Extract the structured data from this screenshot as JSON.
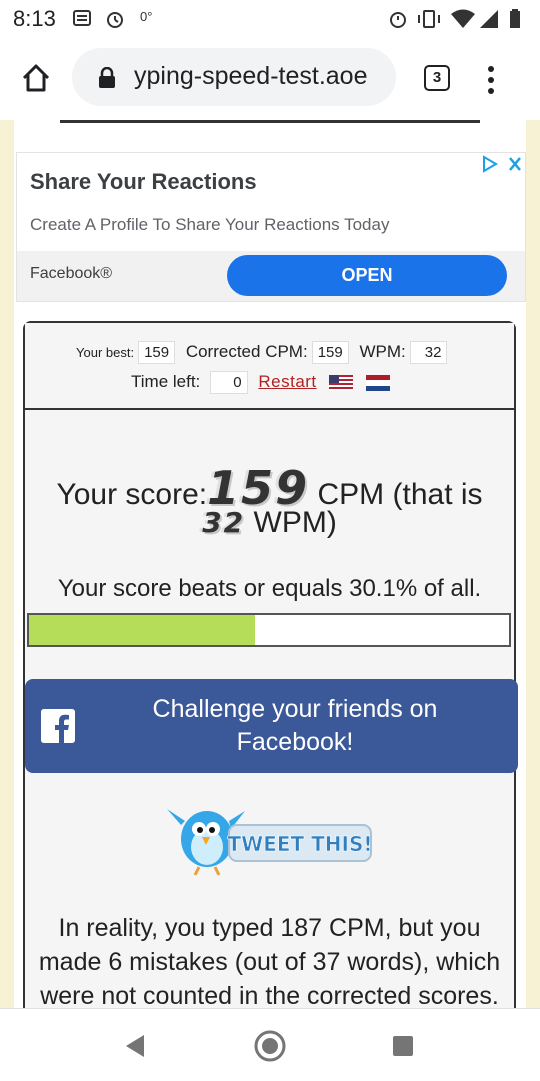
{
  "status_bar": {
    "time": "8:13",
    "left_icons": [
      "news-icon",
      "alarm-icon",
      "temperature-icon"
    ],
    "temperature": "0°",
    "right_icons": [
      "alarm-icon",
      "vibrate-icon",
      "wifi-icon",
      "signal-icon",
      "battery-icon"
    ]
  },
  "browser": {
    "url": "yping-speed-test.aoe",
    "tab_count": "3"
  },
  "ad": {
    "title": "Share Your Reactions",
    "subtitle": "Create A Profile To Share Your Reactions Today",
    "advertiser": "Facebook®",
    "cta": "OPEN"
  },
  "stats": {
    "best_label": "Your best:",
    "best_value": "159",
    "cpm_label": "Corrected CPM:",
    "cpm_value": "159",
    "wpm_label": "WPM:",
    "wpm_value": "32",
    "time_label": "Time left:",
    "time_value": "0",
    "restart_label": "Restart"
  },
  "score": {
    "prefix": "Your score:",
    "cpm": "159",
    "cpm_suffix": "CPM (that is",
    "wpm": "32",
    "wpm_suffix": "WPM)"
  },
  "percentile": {
    "text": "Your score beats or equals 30.1% of all.",
    "fill_fraction": 0.471
  },
  "facebook_button": {
    "label": "Challenge your friends on Facebook!"
  },
  "tweet": {
    "label": "TWEET THIS!"
  },
  "reality_text": "In reality, you typed 187 CPM, but you made 6 mistakes (out of 37 words), which were not counted in the corrected scores.",
  "colors": {
    "page_bg": "#f8f2d4",
    "progress_fill": "#b5dd5a",
    "facebook_blue": "#3b5998",
    "restart_red": "#b22222",
    "ad_button": "#1a73e8"
  }
}
